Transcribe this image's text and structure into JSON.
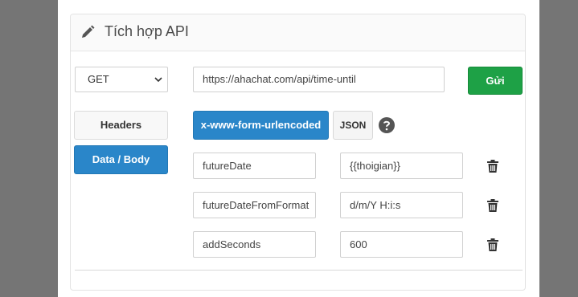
{
  "panel": {
    "title": "Tích hợp API"
  },
  "request": {
    "method": "GET",
    "url": "https://ahachat.com/api/time-until",
    "send_label": "Gửi"
  },
  "tabs": {
    "headers": "Headers",
    "body": "Data / Body"
  },
  "formats": {
    "urlencoded": "x-www-form-urlencoded",
    "json": "JSON"
  },
  "params": [
    {
      "key": "futureDate",
      "value": "{{thoigian}}"
    },
    {
      "key": "futureDateFromFormat",
      "value": "d/m/Y H:i:s"
    },
    {
      "key": "addSeconds",
      "value": "600"
    }
  ],
  "colors": {
    "send": "#1ea146",
    "active": "#2a86c9",
    "backdrop": "#757575"
  },
  "icons": {
    "title": "pencil-icon",
    "help": "help-icon",
    "delete": "trash-icon",
    "select": "chevron-down-icon"
  }
}
